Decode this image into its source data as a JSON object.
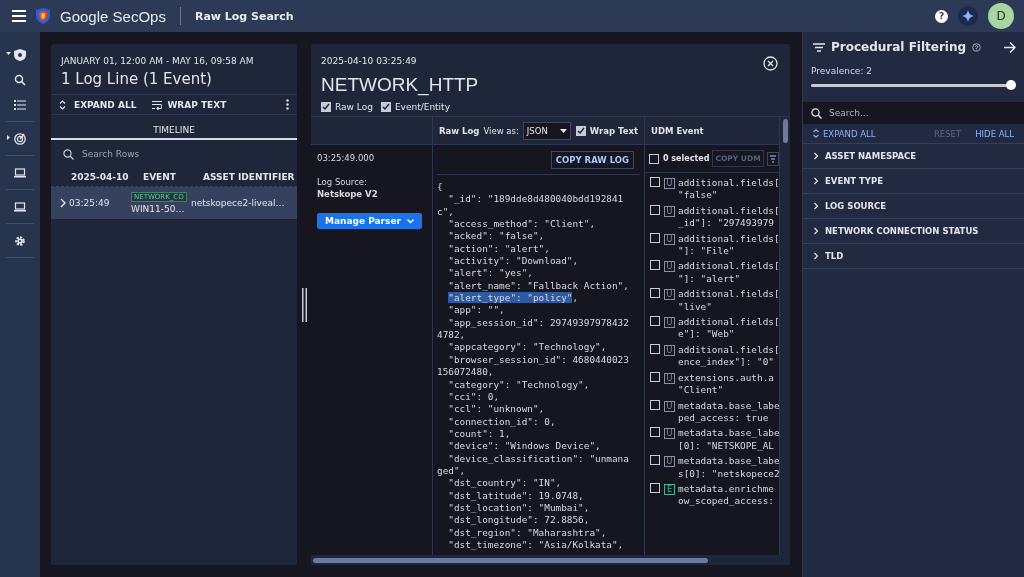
{
  "topbar": {
    "product": "Google SecOps",
    "page": "Raw Log Search",
    "help": "?",
    "avatar": "D"
  },
  "nav": [
    [
      {
        "kind": "shield",
        "expanded": true
      },
      {
        "kind": "search"
      },
      {
        "kind": "list"
      }
    ],
    [
      {
        "kind": "radar",
        "expanded": false
      }
    ],
    [
      {
        "kind": "laptop"
      }
    ],
    [
      {
        "kind": "laptop"
      }
    ],
    [
      {
        "kind": "gear"
      }
    ]
  ],
  "results": {
    "range": "JANUARY 01, 12:00 AM - MAY 16, 09:58 AM",
    "title": "1 Log Line (1 Event)",
    "actions": [
      {
        "label": "EXPAND ALL",
        "kind": "expand"
      },
      {
        "label": "WRAP TEXT",
        "kind": "wrap"
      }
    ],
    "tabs": [
      {
        "label": "TIMELINE",
        "selected": true
      }
    ],
    "search": {
      "placeholder": "Search Rows"
    },
    "columns": [
      "2025-04-10",
      "EVENT",
      "ASSET IDENTIFIER"
    ],
    "rows": [
      {
        "time": "03:25:49",
        "event_type": "NETWORK_CO",
        "event": "WIN11-50…",
        "asset": "netskopece2-liveal…",
        "selected": true
      }
    ]
  },
  "detail": {
    "timestamp": "2025-04-10 03:25:49",
    "title": "NETWORK_HTTP",
    "toggles": [
      {
        "label": "Raw Log",
        "checked": true
      },
      {
        "label": "Event/Entity",
        "checked": true
      }
    ],
    "meta": {
      "time": "03:25:49.000",
      "source_label": "Log Source:",
      "source": "Netskope V2",
      "button": "Manage Parser"
    },
    "raw_log": {
      "label": "Raw Log",
      "view_as_label": "View as:",
      "view_as": "JSON",
      "wrap": {
        "label": "Wrap Text",
        "checked": true
      },
      "copy": "COPY RAW LOG",
      "lines": [
        {
          "text": "{",
          "selected": false
        },
        {
          "text": "  \"_id\": \"189dde8d480040bdd192841",
          "selected": false
        },
        {
          "text": "c\",",
          "selected": false
        },
        {
          "text": "  \"access_method\": \"Client\",",
          "selected": false
        },
        {
          "text": "  \"acked\": \"false\",",
          "selected": false
        },
        {
          "text": "  \"action\": \"alert\",",
          "selected": false
        },
        {
          "text": "  \"activity\": \"Download\",",
          "selected": false
        },
        {
          "text": "  \"alert\": \"yes\",",
          "selected": false
        },
        {
          "text": "  \"alert_name\": \"Fallback Action\",",
          "selected": false
        },
        {
          "text": "\"alert_type\": \"policy\"",
          "selected": true,
          "tail": ","
        },
        {
          "text": "  \"app\": \"\",",
          "selected": false
        },
        {
          "text": "  \"app_session_id\": 29749397978432",
          "selected": false
        },
        {
          "text": "4782,",
          "selected": false
        },
        {
          "text": "  \"appcategory\": \"Technology\",",
          "selected": false
        },
        {
          "text": "  \"browser_session_id\": 4680440023",
          "selected": false
        },
        {
          "text": "156072480,",
          "selected": false
        },
        {
          "text": "  \"category\": \"Technology\",",
          "selected": false
        },
        {
          "text": "  \"cci\": 0,",
          "selected": false
        },
        {
          "text": "  \"ccl\": \"unknown\",",
          "selected": false
        },
        {
          "text": "  \"connection_id\": 0,",
          "selected": false
        },
        {
          "text": "  \"count\": 1,",
          "selected": false
        },
        {
          "text": "  \"device\": \"Windows Device\",",
          "selected": false
        },
        {
          "text": "  \"device_classification\": \"unmana",
          "selected": false
        },
        {
          "text": "ged\",",
          "selected": false
        },
        {
          "text": "  \"dst_country\": \"IN\",",
          "selected": false
        },
        {
          "text": "  \"dst_latitude\": 19.0748,",
          "selected": false
        },
        {
          "text": "  \"dst_location\": \"Mumbai\",",
          "selected": false
        },
        {
          "text": "  \"dst_longitude\": 72.8856,",
          "selected": false
        },
        {
          "text": "  \"dst_region\": \"Maharashtra\",",
          "selected": false
        },
        {
          "text": "  \"dst_timezone\": \"Asia/Kolkata\",",
          "selected": false
        }
      ]
    },
    "udm": {
      "label": "UDM Event",
      "select_all": {
        "label": "0 selected",
        "checked": false
      },
      "copy": {
        "label": "COPY UDM",
        "disabled": true
      },
      "fields": [
        {
          "kind": "event",
          "badge": "U",
          "checked": false,
          "line1": "additional.fields[",
          "line2": "\"false\""
        },
        {
          "kind": "event",
          "badge": "U",
          "checked": false,
          "line1": "additional.fields[",
          "line2": "_id\"]: \"297493979"
        },
        {
          "kind": "event",
          "badge": "U",
          "checked": false,
          "line1": "additional.fields[",
          "line2": "\"]: \"File\""
        },
        {
          "kind": "event",
          "badge": "U",
          "checked": false,
          "line1": "additional.fields[",
          "line2": "\"]: \"alert\""
        },
        {
          "kind": "event",
          "badge": "U",
          "checked": false,
          "line1": "additional.fields[",
          "line2": "\"live\""
        },
        {
          "kind": "event",
          "badge": "U",
          "checked": false,
          "line1": "additional.fields[",
          "line2": "e\"]: \"Web\""
        },
        {
          "kind": "event",
          "badge": "U",
          "checked": false,
          "line1": "additional.fields[",
          "line2": "ence_index\"]: \"0\""
        },
        {
          "kind": "event",
          "badge": "U",
          "checked": false,
          "line1": "extensions.auth.a",
          "line2": "\"Client\""
        },
        {
          "kind": "event",
          "badge": "U",
          "checked": false,
          "line1": "metadata.base_labe",
          "line2": "ped_access: true"
        },
        {
          "kind": "event",
          "badge": "U",
          "checked": false,
          "line1": "metadata.base_labe",
          "line2": "[0]: \"NETSKOPE_AL"
        },
        {
          "kind": "event",
          "badge": "U",
          "checked": false,
          "line1": "metadata.base_labe",
          "line2": "s[0]: \"netskopece2"
        },
        {
          "kind": "entity",
          "badge": "E",
          "checked": false,
          "line1": "metadata.enrichme",
          "line2": "ow_scoped_access:"
        }
      ]
    }
  },
  "filters": {
    "title": "Procedural Filtering",
    "prevalence": {
      "label": "Prevalence: 2",
      "level": 1
    },
    "search": {
      "placeholder": "Search..."
    },
    "actions": [
      {
        "label": "EXPAND ALL",
        "kind": "expand",
        "disabled": false
      },
      {
        "label": "RESET",
        "kind": "plain",
        "disabled": true
      },
      {
        "label": "HIDE ALL",
        "kind": "plain",
        "disabled": false
      }
    ],
    "sections": [
      {
        "label": "ASSET NAMESPACE",
        "expanded": false
      },
      {
        "label": "EVENT TYPE",
        "expanded": false
      },
      {
        "label": "LOG SOURCE",
        "expanded": false
      },
      {
        "label": "NETWORK CONNECTION STATUS",
        "expanded": false
      },
      {
        "label": "TLD",
        "expanded": false
      }
    ]
  }
}
